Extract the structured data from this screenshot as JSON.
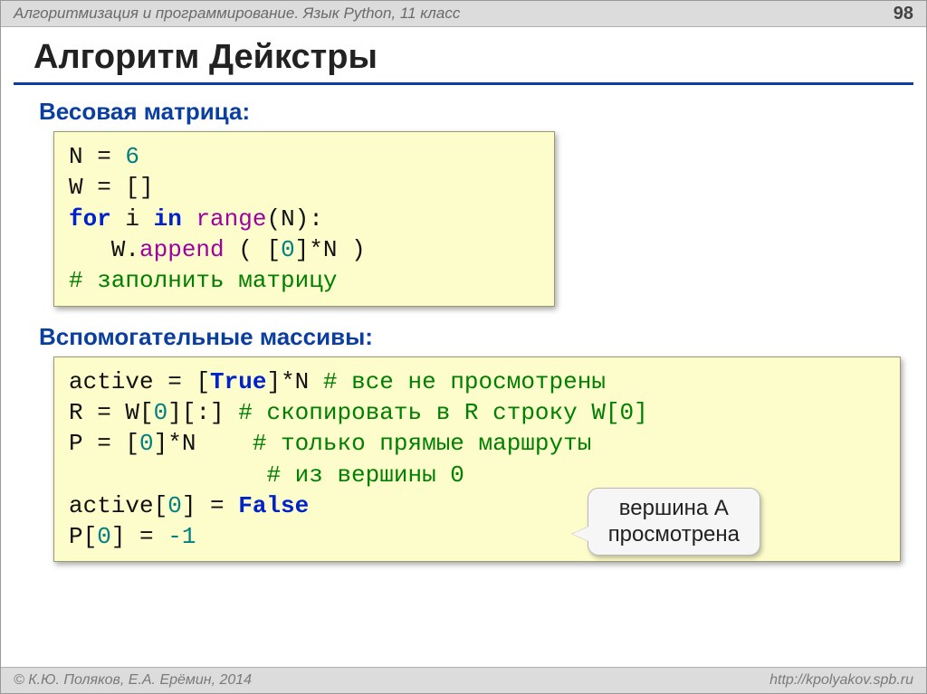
{
  "header": {
    "course": "Алгоритмизация и программирование. Язык Python, 11 класс",
    "page_number": "98"
  },
  "title": "Алгоритм Дейкстры",
  "section1": {
    "label": "Весовая матрица:",
    "code": {
      "l1_a": "N",
      "l1_eq": " = ",
      "l1_b": "6",
      "l2_a": "W",
      "l2_eq": " = ",
      "l2_b": "[]",
      "l3_a": "for",
      "l3_b": " i ",
      "l3_c": "in",
      "l3_d": " ",
      "l3_e": "range",
      "l3_f": "(N):",
      "l4_a": "   W.",
      "l4_b": "append",
      "l4_c": " ( [",
      "l4_d": "0",
      "l4_e": "]*N )",
      "l5": "# заполнить матрицу"
    }
  },
  "section2": {
    "label": "Вспомогательные массивы:",
    "code": {
      "l1_a": "active",
      "l1_eq": " = ",
      "l1_b": "[",
      "l1_c": "True",
      "l1_d": "]*N ",
      "l1_e": "# все не просмотрены",
      "l2_a": "R",
      "l2_eq": " = ",
      "l2_b": "W[",
      "l2_c": "0",
      "l2_d": "][:] ",
      "l2_e": "# скопировать в R строку W[0]",
      "l3_a": "P",
      "l3_eq": " = ",
      "l3_b": "[",
      "l3_c": "0",
      "l3_d": "]*N    ",
      "l3_e": "# только прямые маршруты",
      "l4_a": "              ",
      "l4_b": "# из вершины 0",
      "l5_a": "active[",
      "l5_b": "0",
      "l5_c": "]",
      "l5_eq": " = ",
      "l5_d": "False",
      "l6_a": "P[",
      "l6_b": "0",
      "l6_c": "]",
      "l6_eq": " = ",
      "l6_d": "-1"
    },
    "callout": {
      "line1": "вершина A",
      "line2": "просмотрена"
    }
  },
  "footer": {
    "left": "© К.Ю. Поляков, Е.А. Ерёмин, 2014",
    "right": "http://kpolyakov.spb.ru"
  }
}
